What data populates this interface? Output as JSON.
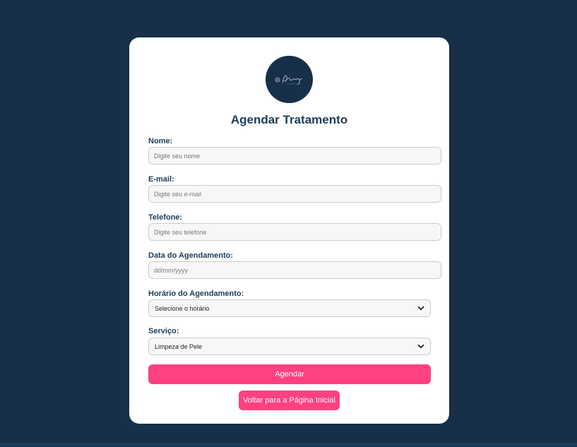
{
  "form": {
    "title": "Agendar Tratamento",
    "submit_label": "Agendar",
    "back_label": "Voltar para a Página Inicial"
  },
  "fields": {
    "nome": {
      "label": "Nome:",
      "placeholder": "Digite seu nome"
    },
    "email": {
      "label": "E-mail:",
      "placeholder": "Digite seu e-mail"
    },
    "telefone": {
      "label": "Telefone:",
      "placeholder": "Digite seu telefone"
    },
    "data": {
      "label": "Data do Agendamento:",
      "placeholder": "dd/mm/yyyy"
    },
    "horario": {
      "label": "Horário do Agendamento:",
      "selected": "Selecione o horário"
    },
    "servico": {
      "label": "Serviço:",
      "selected": "Limpeza de Pele"
    }
  },
  "colors": {
    "page_background": "#172f48",
    "card_background": "#ffffff",
    "accent": "#ff4081",
    "heading": "#1b3d5a"
  },
  "icons": {
    "logo": "brand-logo-icon",
    "dropdown": "chevron-down-icon"
  }
}
